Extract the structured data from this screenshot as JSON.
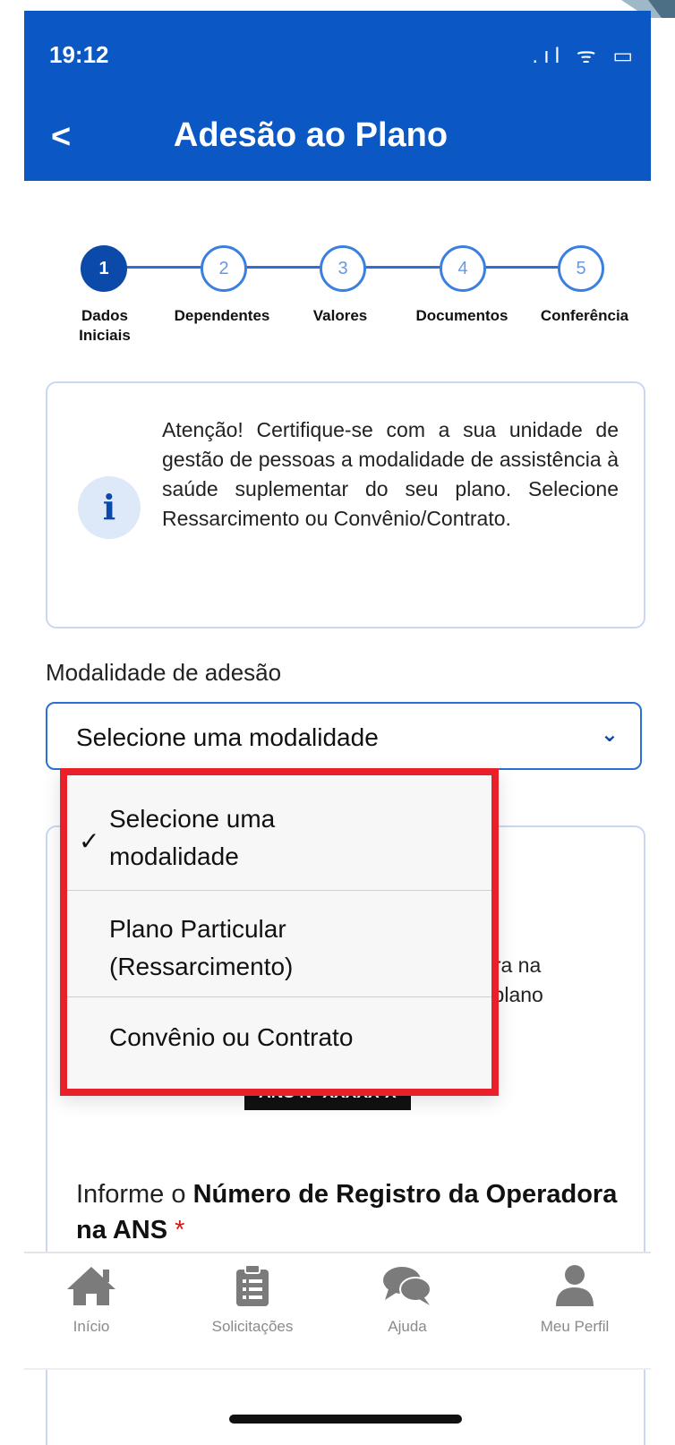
{
  "status_bar": {
    "time": "19:12",
    "icons": ".ıl ᯤ ▭"
  },
  "header": {
    "back_label": "<",
    "title": "Adesão ao Plano",
    "color": "#0b57c4"
  },
  "stepper": {
    "steps": [
      {
        "number": "1",
        "label_line1": "Dados",
        "label_line2": "Iniciais",
        "active": true
      },
      {
        "number": "2",
        "label_line1": "Dependentes",
        "label_line2": ""
      },
      {
        "number": "3",
        "label_line1": "Valores",
        "label_line2": ""
      },
      {
        "number": "4",
        "label_line1": "Documentos",
        "label_line2": ""
      },
      {
        "number": "5",
        "label_line1": "Conferência",
        "label_line2": ""
      }
    ]
  },
  "info": {
    "icon": "info-icon",
    "text": "Atenção! Certifique-se com a sua unidade de gestão de pessoas a modalidade de assistência à saúde suplementar do seu plano. Selecione Ressarcimento ou Convênio/Contrato."
  },
  "form": {
    "modalidade_label": "Modalidade de adesão",
    "select_value": "Selecione uma modalidade",
    "chevron": "⌄"
  },
  "dropdown": {
    "check": "✓",
    "options": [
      {
        "line1": "Selecione uma",
        "line2": "modalidade",
        "selected": true
      },
      {
        "line1": "Plano Particular",
        "line2": "(Ressarcimento)"
      },
      {
        "line1": "Convênio ou Contrato",
        "line2": ""
      }
    ]
  },
  "card": {
    "partial_line1": "eradora na",
    "partial_line2": "to do plano",
    "partial_line3": ":",
    "ans_badge": "ANS Nº XXXXX-X",
    "informe_prefix": "Informe o ",
    "informe_bold": "Número de Registro da Operadora na ANS",
    "required_mark": "*"
  },
  "bottom_nav": {
    "items": [
      {
        "label": "Início",
        "icon": "home-icon"
      },
      {
        "label": "Solicitações",
        "icon": "clipboard-icon"
      },
      {
        "label": "Ajuda",
        "icon": "chat-icon"
      },
      {
        "label": "Meu Perfil",
        "icon": "user-icon"
      }
    ]
  }
}
